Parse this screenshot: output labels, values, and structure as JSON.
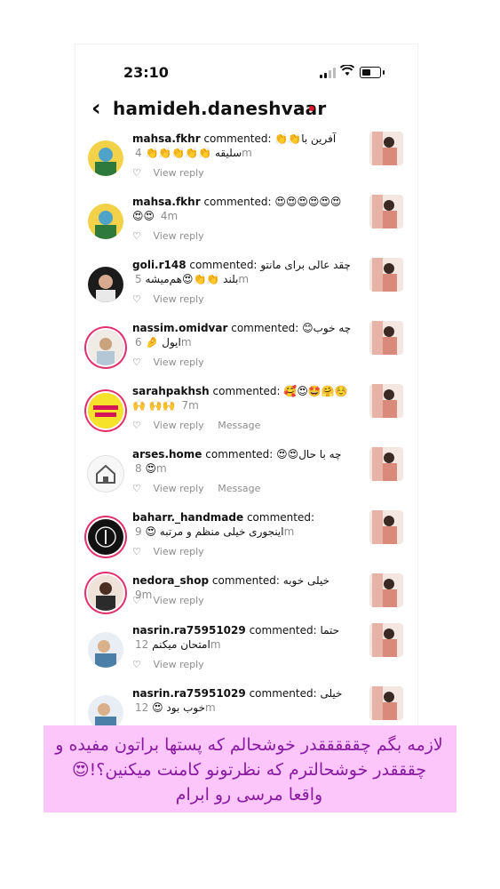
{
  "status": {
    "time": "23:10"
  },
  "header": {
    "username": "hamideh.daneshvaar"
  },
  "comments": [
    {
      "user": "mahsa.fkhr",
      "verb": "commented:",
      "text": "👏👏آفرین با سلیقه 👏👏👏👏👏",
      "time": "4m",
      "reply": "View reply",
      "message": ""
    },
    {
      "user": "mahsa.fkhr",
      "verb": "commented:",
      "text": "😍😍😍😍😍😍 😍😍",
      "time": "4m",
      "reply": "View reply",
      "message": ""
    },
    {
      "user": "goli.r148",
      "verb": "commented:",
      "text": "چقد عالی برای مانتو بلند 👏👏😍هم‌میشه",
      "time": "5m",
      "reply": "View reply",
      "message": ""
    },
    {
      "user": "nassim.omidvar",
      "verb": "commented:",
      "text": "😊چه خوب ایول 🤌",
      "time": "6m",
      "reply": "View reply",
      "message": ""
    },
    {
      "user": "sarahpakhsh",
      "verb": "commented:",
      "text": "🥰😍🤩🤗☺️🙌 🙌🙌",
      "time": "7m",
      "reply": "View reply",
      "message": "Message"
    },
    {
      "user": "arses.home",
      "verb": "commented:",
      "text": "😍😍چه با حال 😍",
      "time": "8m",
      "reply": "View reply",
      "message": "Message"
    },
    {
      "user": "baharr._handmade",
      "verb": "commented:",
      "text": "اینجوری خیلی منظم و مرتبه 😍",
      "time": "9m",
      "reply": "View reply",
      "message": ""
    },
    {
      "user": "nedora_shop",
      "verb": "commented:",
      "text": "خیلی خوبه",
      "time": "9m",
      "reply": "View reply",
      "message": ""
    },
    {
      "user": "nasrin.ra75951029",
      "verb": "commented:",
      "text": "حتما امتحان میکنم",
      "time": "12m",
      "reply": "View reply",
      "message": ""
    },
    {
      "user": "nasrin.ra75951029",
      "verb": "commented:",
      "text": "خیلی خوب بود 😍",
      "time": "12m",
      "reply": "",
      "message": ""
    }
  ],
  "banner": {
    "line1": "لازمه بگم چقققققدر خوشحالم که پستها براتون مفیده و",
    "line2": "چقققدر خوشحالترم که نظرتونو کامنت میکنین؟!😍",
    "line3": "واقعا مرسی رو ابرام"
  },
  "colors": {
    "banner_bg": "#fcc6fa",
    "banner_text": "#8a1aa2",
    "notification_dot": "#e0142a"
  }
}
